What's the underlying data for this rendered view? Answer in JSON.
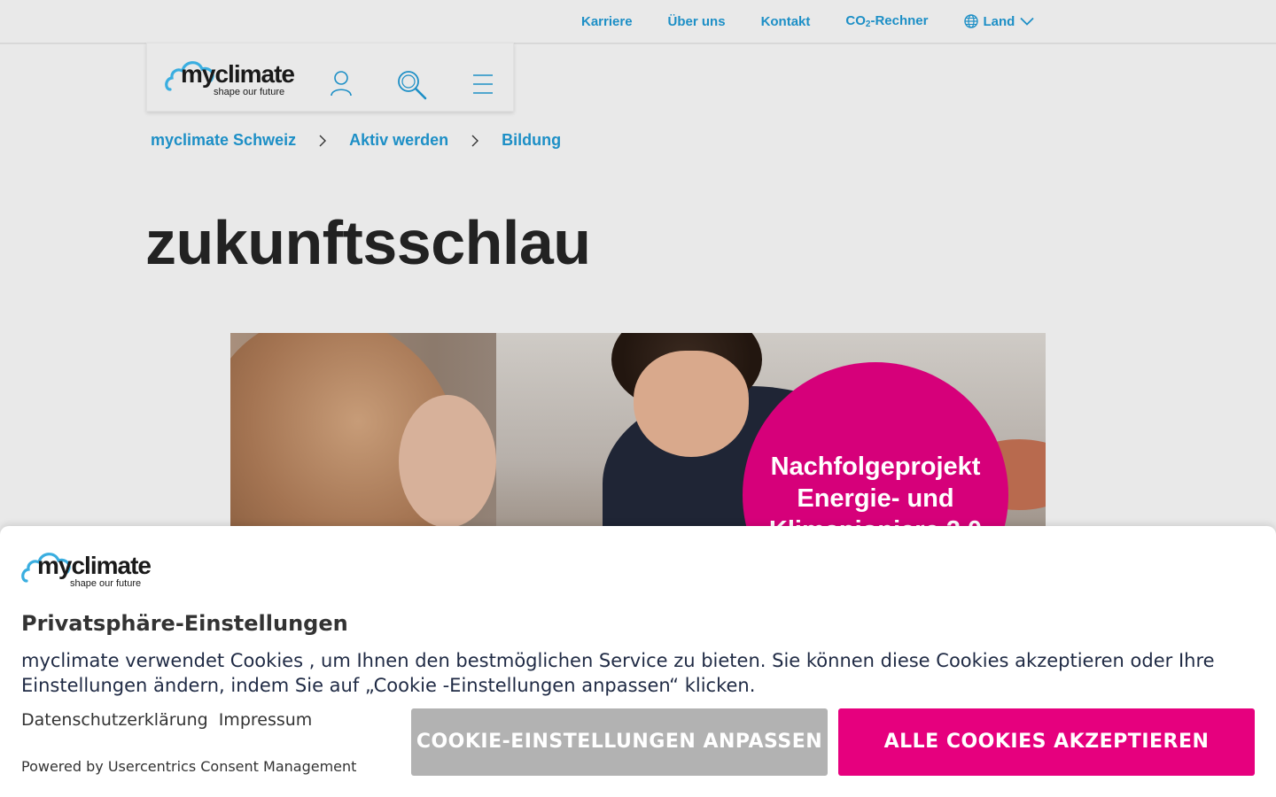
{
  "topnav": {
    "karriere": "Karriere",
    "ueber_uns": "Über uns",
    "kontakt": "Kontakt",
    "co2_prefix": "CO",
    "co2_sub": "2",
    "co2_suffix": "-Rechner",
    "land": "Land"
  },
  "logo": {
    "name": "myclimate",
    "tagline": "shape our future"
  },
  "header_icons": [
    "user-icon",
    "search-icon",
    "menu-icon"
  ],
  "breadcrumb": [
    "myclimate Schweiz",
    "Aktiv werden",
    "Bildung"
  ],
  "page": {
    "title": "zukunftsschlau"
  },
  "hero": {
    "badge_lines": [
      "Nachfolgeprojekt",
      "Energie- und",
      "Klimapioniere 2.0"
    ]
  },
  "cookie": {
    "heading": "Privatsphäre-Einstellungen",
    "text": "myclimate verwendet Cookies , um Ihnen den bestmöglichen Service zu bieten. Sie können diese Cookies akzeptieren oder Ihre Einstellungen ändern, indem Sie auf „Cookie -Einstellungen anpassen“ klicken.",
    "link_privacy": "Datenschutzerklärung",
    "link_imprint": "Impressum",
    "powered": "Powered by Usercentrics Consent Management",
    "btn_settings": "COOKIE-EINSTELLUNGEN ANPASSEN",
    "btn_accept": "ALLE COOKIES AKZEPTIEREN"
  },
  "colors": {
    "link_blue": "#1d8fc6",
    "magenta": "#e6007e",
    "background": "#e9e9e9"
  }
}
